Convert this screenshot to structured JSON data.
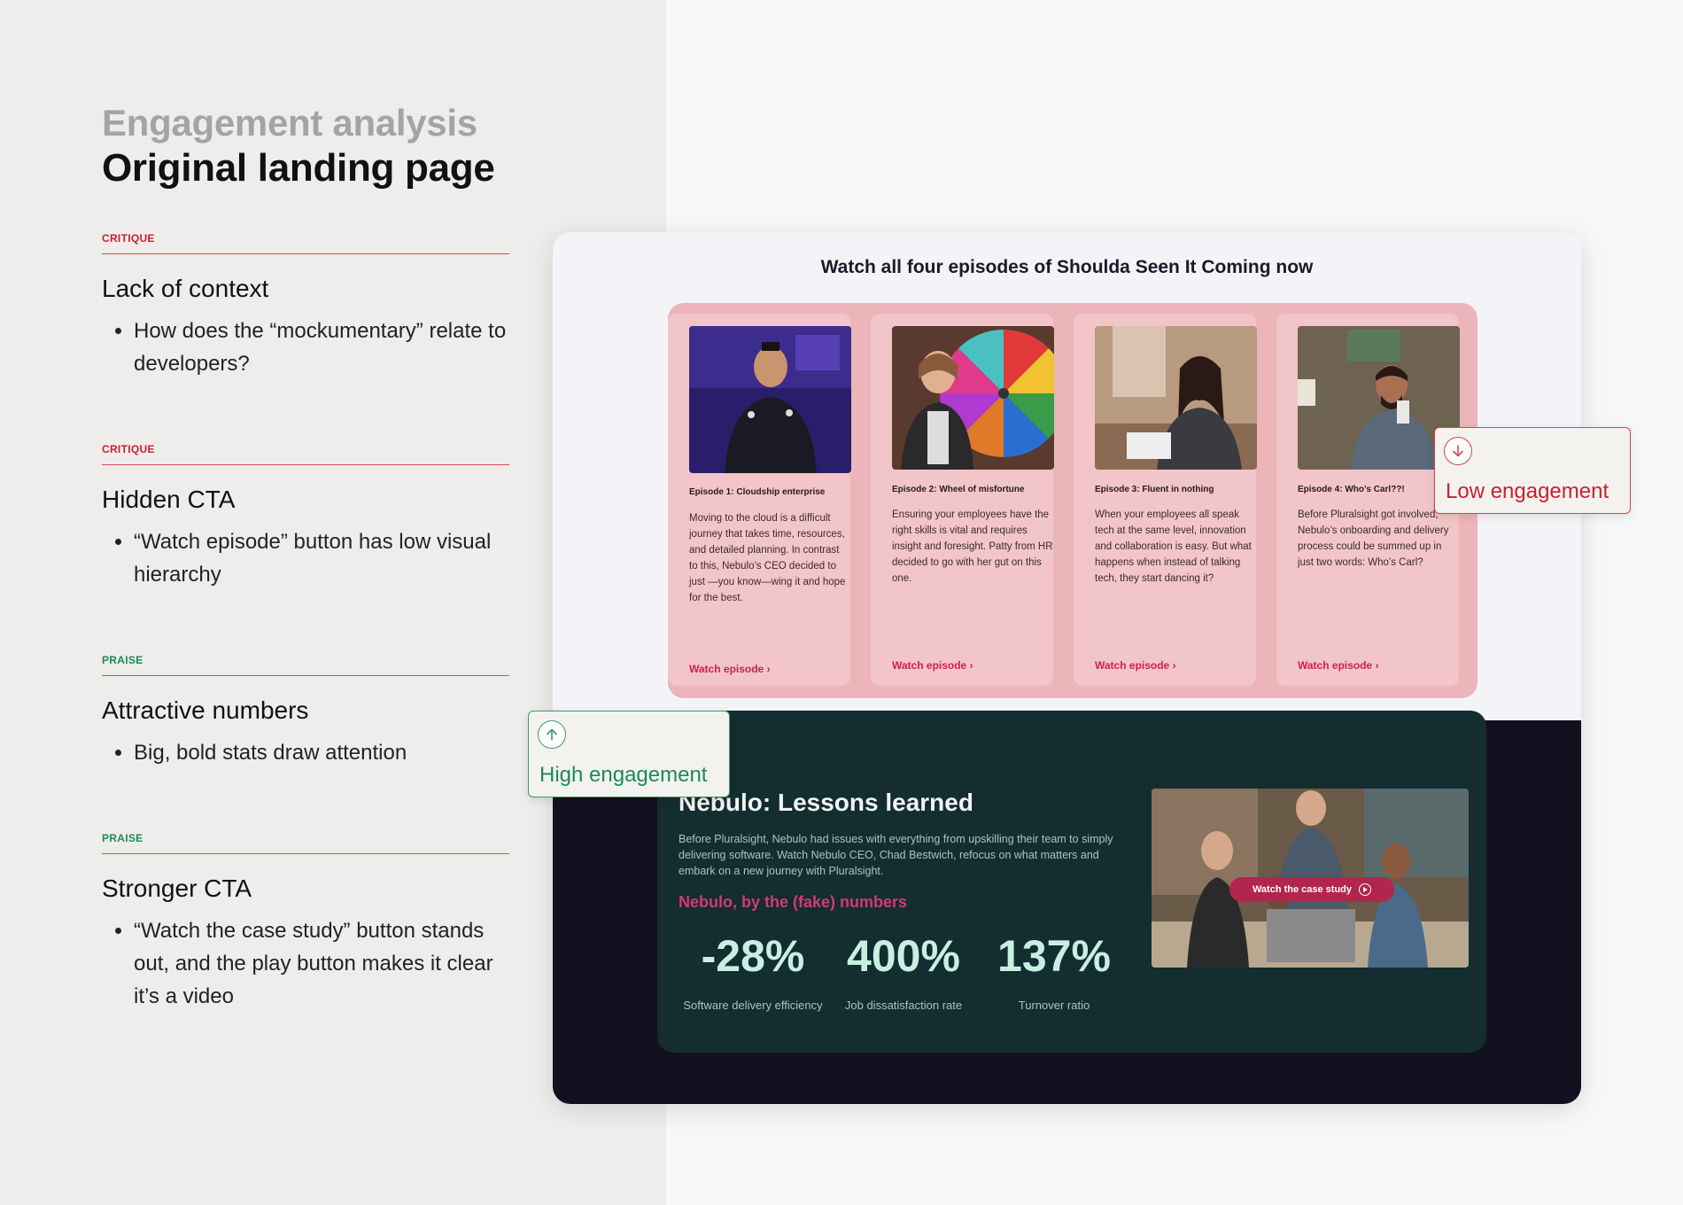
{
  "header": {
    "subtitle": "Engagement analysis",
    "title": "Original landing page"
  },
  "notes": [
    {
      "tag": "CRITIQUE",
      "title": "Lack of context",
      "bullet": "How does the “mockumentary” relate to developers?"
    },
    {
      "tag": "CRITIQUE",
      "title": "Hidden CTA",
      "bullet": "“Watch episode” button has low visual hierarchy"
    },
    {
      "tag": "PRAISE",
      "title": "Attractive numbers",
      "bullet": "Big, bold stats draw attention"
    },
    {
      "tag": "PRAISE",
      "title": "Stronger CTA",
      "bullet": "“Watch the case study” button stands out, and the play button makes it clear it’s a video"
    }
  ],
  "mockup": {
    "section_title": "Watch all four episodes of Shoulda Seen It Coming now",
    "episodes": [
      {
        "title": "Episode 1: Cloudship enterprise",
        "description": "Moving to the cloud is a difficult journey that takes time, resources, and detailed planning. In contrast to this, Nebulo’s CEO decided to just —you know—wing it and hope for the best.",
        "link": "Watch episode"
      },
      {
        "title": "Episode 2: Wheel of misfortune",
        "description": "Ensuring your employees have the right skills is vital and requires insight and foresight. Patty from HR decided to go with her gut on this one.",
        "link": "Watch episode"
      },
      {
        "title": "Episode 3: Fluent in nothing",
        "description": "When your employees all speak tech at the same level, innovation and collaboration is easy. But what happens when instead of talking tech, they start dancing it?",
        "link": "Watch episode"
      },
      {
        "title": "Episode 4: Who’s Carl??!",
        "description": "Before Pluralsight got involved, Nebulo’s onboarding and delivery process could be summed up in just two words: Who’s Carl?",
        "link": "Watch episode"
      }
    ],
    "case_study": {
      "title": "Nebulo: Lessons learned",
      "description": "Before Pluralsight, Nebulo had issues with everything from upskilling their team to simply delivering software. Watch Nebulo CEO, Chad Bestwich, refocus on what matters and embark on a new journey with Pluralsight.",
      "numbers_heading": "Nebulo, by the (fake) numbers",
      "stats": [
        {
          "value": "-28%",
          "label": "Software delivery efficiency"
        },
        {
          "value": "400%",
          "label": "Job dissatisfaction rate"
        },
        {
          "value": "137%",
          "label": "Turnover ratio"
        }
      ],
      "cta_label": "Watch the case study"
    }
  },
  "badges": {
    "low": {
      "label": "Low engagement",
      "icon": "arrow-down-icon"
    },
    "high": {
      "label": "High engagement",
      "icon": "arrow-up-icon"
    }
  },
  "colors": {
    "critique": "#c8202f",
    "praise": "#1c8a57",
    "cta_pink": "#d01f4f"
  }
}
